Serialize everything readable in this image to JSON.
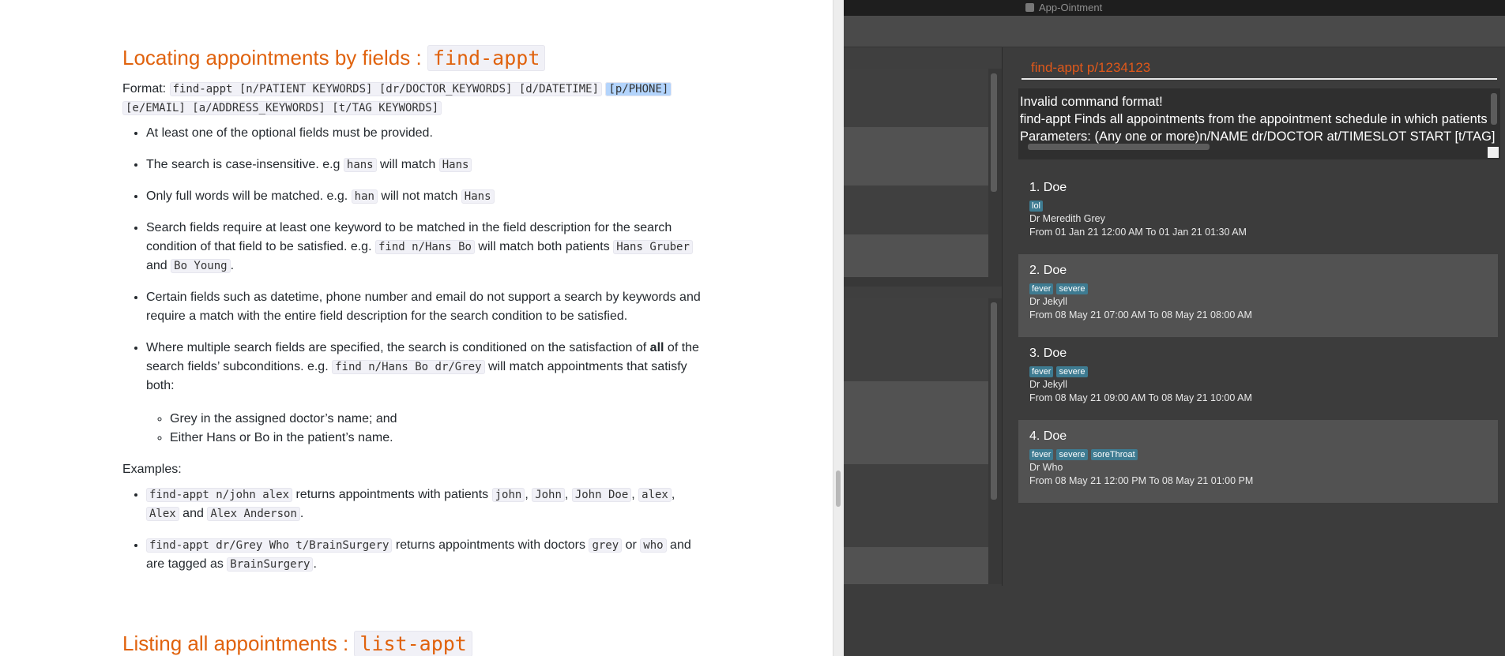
{
  "doc": {
    "heading1": "Locating appointments by fields : ",
    "heading1_code": "find-appt",
    "format_label": "Format: ",
    "format_code1": "find-appt [n/PATIENT KEYWORDS] [dr/DOCTOR_KEYWORDS] [d/DATETIME]",
    "format_code_hl": "[p/PHONE]",
    "format_code2": "[e/EMAIL] [a/ADDRESS_KEYWORDS] [t/TAG KEYWORDS]",
    "b1": "At least one of the optional fields must be provided.",
    "b2_a": "The search is case-insensitive. e.g ",
    "b2_c1": "hans",
    "b2_b": " will match ",
    "b2_c2": "Hans",
    "b3_a": "Only full words will be matched. e.g. ",
    "b3_c1": "han",
    "b3_b": " will not match ",
    "b3_c2": "Hans",
    "b4_a": "Search fields require at least one keyword to be matched in the field description for the search condition of that field to be satisfied. e.g. ",
    "b4_c1": "find n/Hans Bo",
    "b4_b": " will match both patients ",
    "b4_c2": "Hans Gruber",
    "b4_c": " and ",
    "b4_c3": "Bo Young",
    "b4_d": ".",
    "b5": "Certain fields such as datetime, phone number and email do not support a search by keywords and require a match with the entire field description for the search condition to be satisfied.",
    "b6_a": "Where multiple search fields are specified, the search is conditioned on the satisfaction of ",
    "b6_bold": "all",
    "b6_b": " of the search fields’ subconditions. e.g. ",
    "b6_c1": "find n/Hans Bo dr/Grey",
    "b6_c": " will match appointments that satisfy both:",
    "sub1": "Grey in the assigned doctor’s name; and",
    "sub2": "Either Hans or Bo in the patient’s name.",
    "examples_label": "Examples:",
    "e1_c1": "find-appt n/john alex",
    "e1_a": " returns appointments with patients ",
    "e1_c2": "john",
    "e1_sep1": ", ",
    "e1_c3": "John",
    "e1_sep2": ", ",
    "e1_c4": "John Doe",
    "e1_sep3": ", ",
    "e1_c5": "alex",
    "e1_sep4": ", ",
    "e1_c6": "Alex",
    "e1_and": " and ",
    "e1_c7": "Alex Anderson",
    "e1_end": ".",
    "e2_c1": "find-appt dr/Grey Who t/BrainSurgery",
    "e2_a": " returns appointments with doctors ",
    "e2_c2": "grey",
    "e2_or": " or ",
    "e2_c3": "who",
    "e2_b": " and are tagged as ",
    "e2_c4": "BrainSurgery",
    "e2_end": ".",
    "heading2": "Listing all appointments : ",
    "heading2_code": "list-appt"
  },
  "app": {
    "title": "App-Ointment",
    "command_input": "find-appt p/1234123",
    "result_line1": "Invalid command format!",
    "result_line2": "find-appt Finds all appointments from the appointment schedule in which patients",
    "result_line3": "Parameters: (Any one or more)n/NAME dr/DOCTOR at/TIMESLOT START [t/TAG]",
    "appointments": [
      {
        "name": "1.  Doe",
        "tags": [
          "lol"
        ],
        "doctor": "Dr Meredith Grey",
        "timeslot": "From 01 Jan 21 12:00 AM To 01 Jan 21 01:30 AM"
      },
      {
        "name": "2.  Doe",
        "tags": [
          "fever",
          "severe"
        ],
        "doctor": "Dr Jekyll",
        "timeslot": "From 08 May 21 07:00 AM To 08 May 21 08:00 AM"
      },
      {
        "name": "3.  Doe",
        "tags": [
          "fever",
          "severe"
        ],
        "doctor": "Dr Jekyll",
        "timeslot": "From 08 May 21 09:00 AM To 08 May 21 10:00 AM"
      },
      {
        "name": "4.  Doe",
        "tags": [
          "fever",
          "severe",
          "soreThroat"
        ],
        "doctor": "Dr Who",
        "timeslot": "From 08 May 21 12:00 PM To 08 May 21 01:00 PM"
      }
    ],
    "colors": {
      "accent": "#e0581a",
      "tag": "#3e7b91",
      "background": "#3c3c3c"
    }
  }
}
